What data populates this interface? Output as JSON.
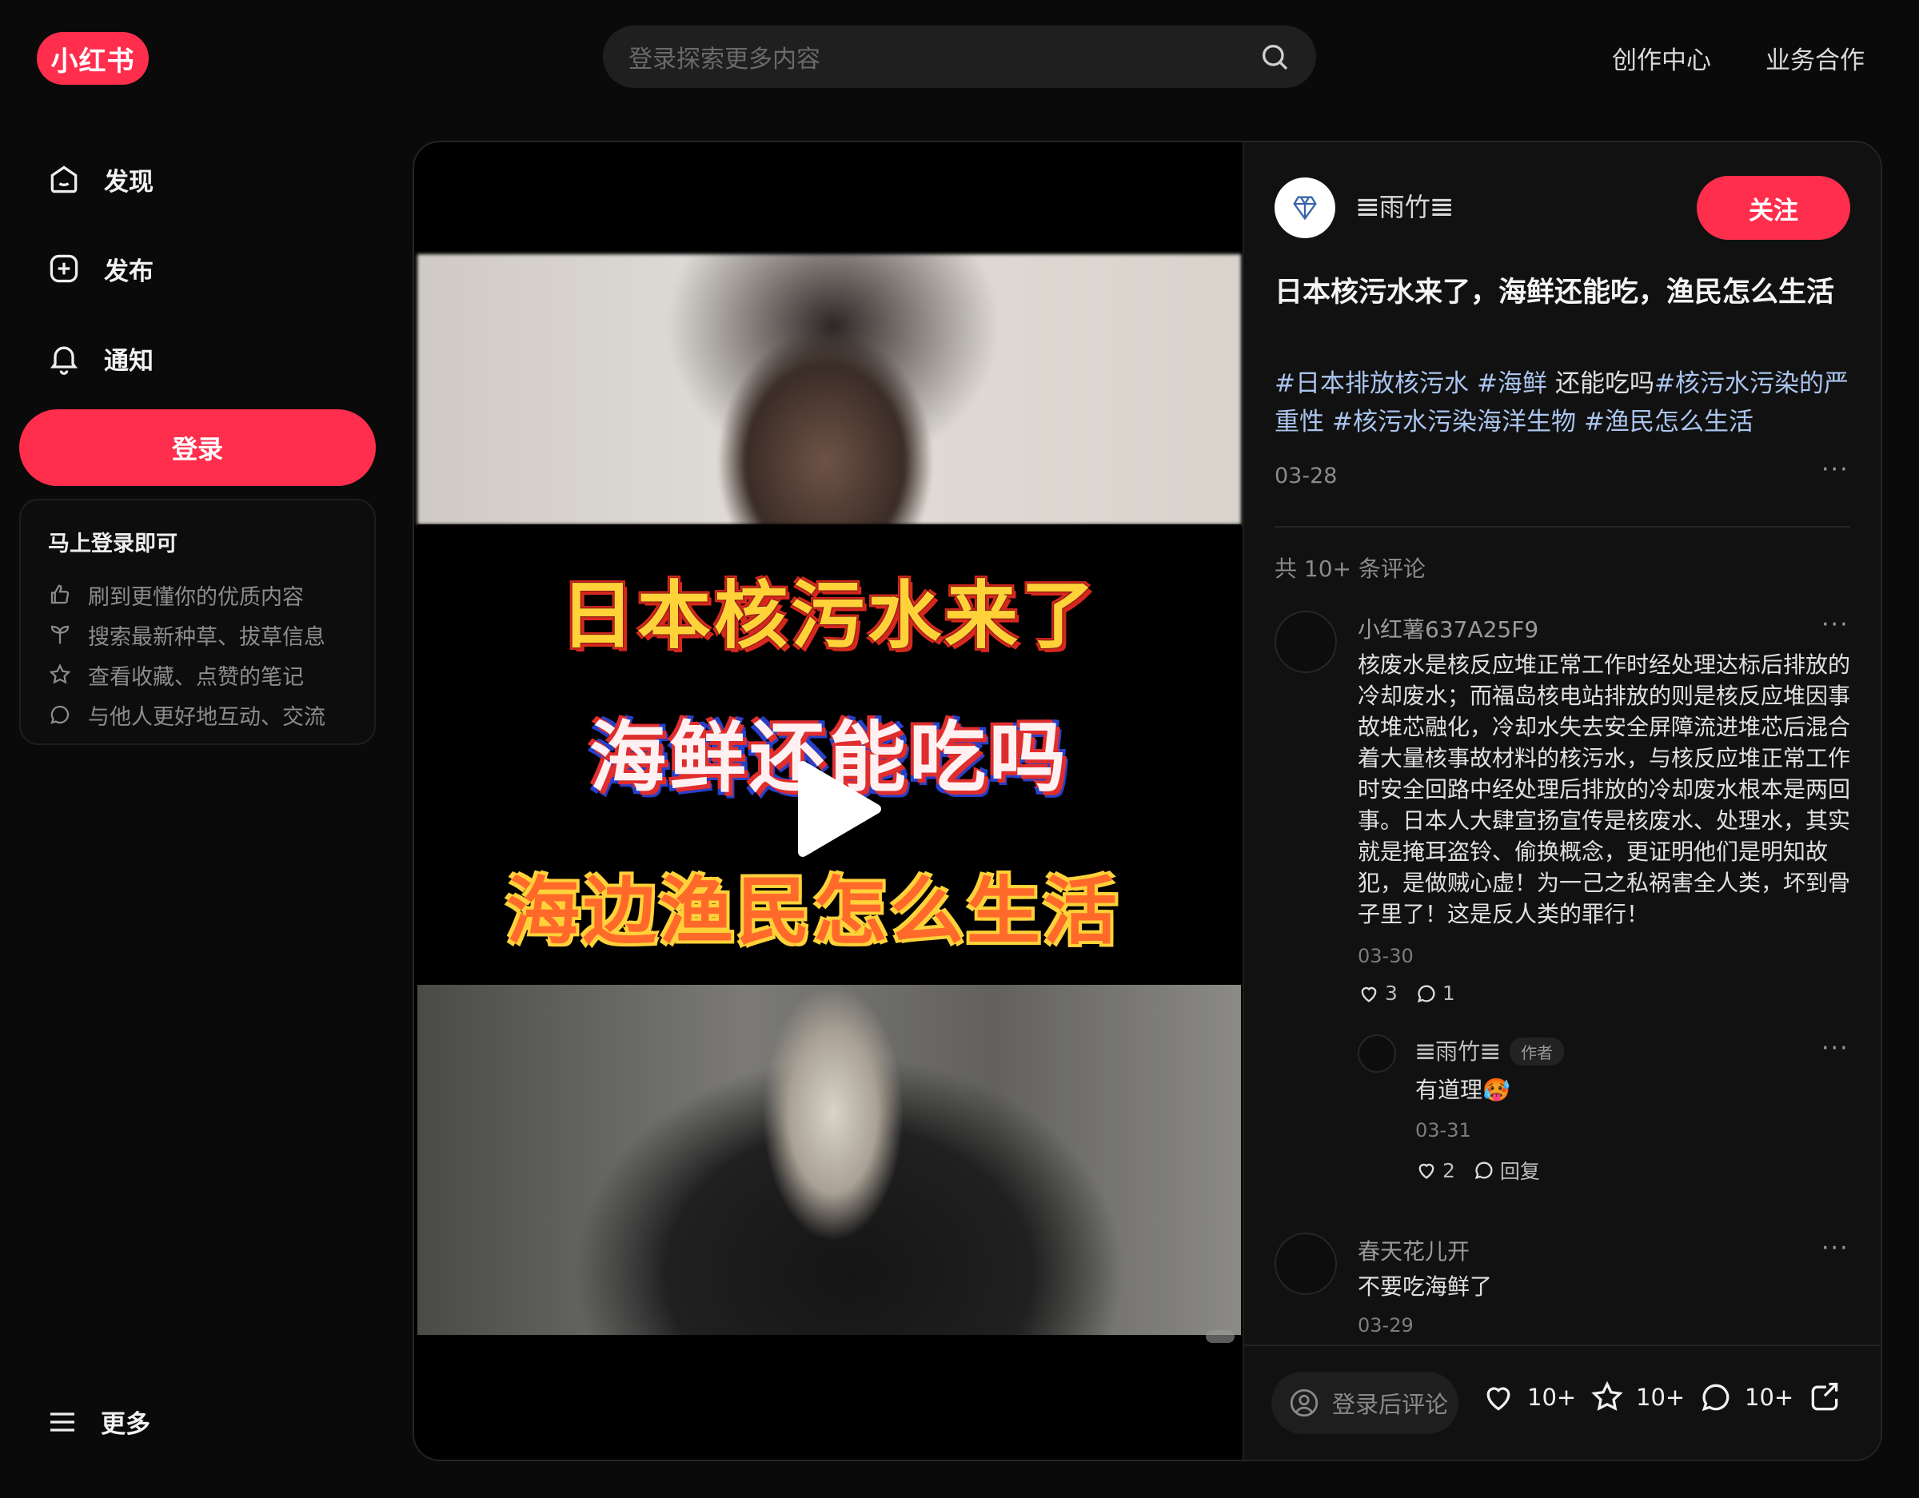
{
  "header": {
    "logo_text": "小红书",
    "search_placeholder": "登录探索更多内容",
    "links": [
      "创作中心",
      "业务合作"
    ]
  },
  "sidebar": {
    "items": [
      {
        "label": "发现",
        "icon": "home-icon"
      },
      {
        "label": "发布",
        "icon": "plus-square-icon"
      },
      {
        "label": "通知",
        "icon": "bell-icon"
      }
    ],
    "login_label": "登录",
    "promo": {
      "title": "马上登录即可",
      "rows": [
        {
          "text": "刷到更懂你的优质内容",
          "icon": "thumbs-up-icon"
        },
        {
          "text": "搜索最新种草、拔草信息",
          "icon": "sprout-icon"
        },
        {
          "text": "查看收藏、点赞的笔记",
          "icon": "star-icon"
        },
        {
          "text": "与他人更好地互动、交流",
          "icon": "chat-bubble-icon"
        }
      ]
    },
    "more_label": "更多"
  },
  "video": {
    "captions": [
      "日本核污水来了",
      "海鲜还能吃吗",
      "海边渔民怎么生活"
    ]
  },
  "note": {
    "author": "𝌆雨竹𝌆",
    "follow_label": "关注",
    "title": "日本核污水来了，海鲜还能吃，渔民怎么生活",
    "tags": [
      "#日本排放核污水",
      "#海鲜",
      "还能吃吗",
      "#核污水污染的严重性",
      "#核污水污染海洋生物",
      "#渔民怎么生活"
    ],
    "date": "03-28",
    "comment_count_text": "共 10+ 条评论"
  },
  "comments": [
    {
      "user": "小红薯637A25F9",
      "text": "核废水是核反应堆正常工作时经处理达标后排放的冷却废水；而福岛核电站排放的则是核反应堆因事故堆芯融化，冷却水失去安全屏障流进堆芯后混合着大量核事故材料的核污水，与核反应堆正常工作时安全回路中经处理后排放的冷却废水根本是两回事。日本人大肆宣扬宣传是核废水、处理水，其实就是掩耳盗铃、偷换概念，更证明他们是明知故犯，是做贼心虚！为一己之私祸害全人类，坏到骨子里了！这是反人类的罪行！",
      "date": "03-30",
      "likes": "3",
      "replies": "1",
      "reply": {
        "user": "𝌆雨竹𝌆",
        "badge": "作者",
        "text": "有道理🥵",
        "date": "03-31",
        "likes": "2",
        "reply_label": "回复"
      }
    },
    {
      "user": "春天花儿开",
      "text": "不要吃海鲜了",
      "date": "03-29"
    }
  ],
  "bottom_bar": {
    "comment_placeholder": "登录后评论",
    "likes": "10+",
    "collects": "10+",
    "comments": "10+"
  },
  "colors": {
    "accent": "#ff2e4d",
    "tag": "#aac4ee",
    "background": "#0a0a0a"
  }
}
